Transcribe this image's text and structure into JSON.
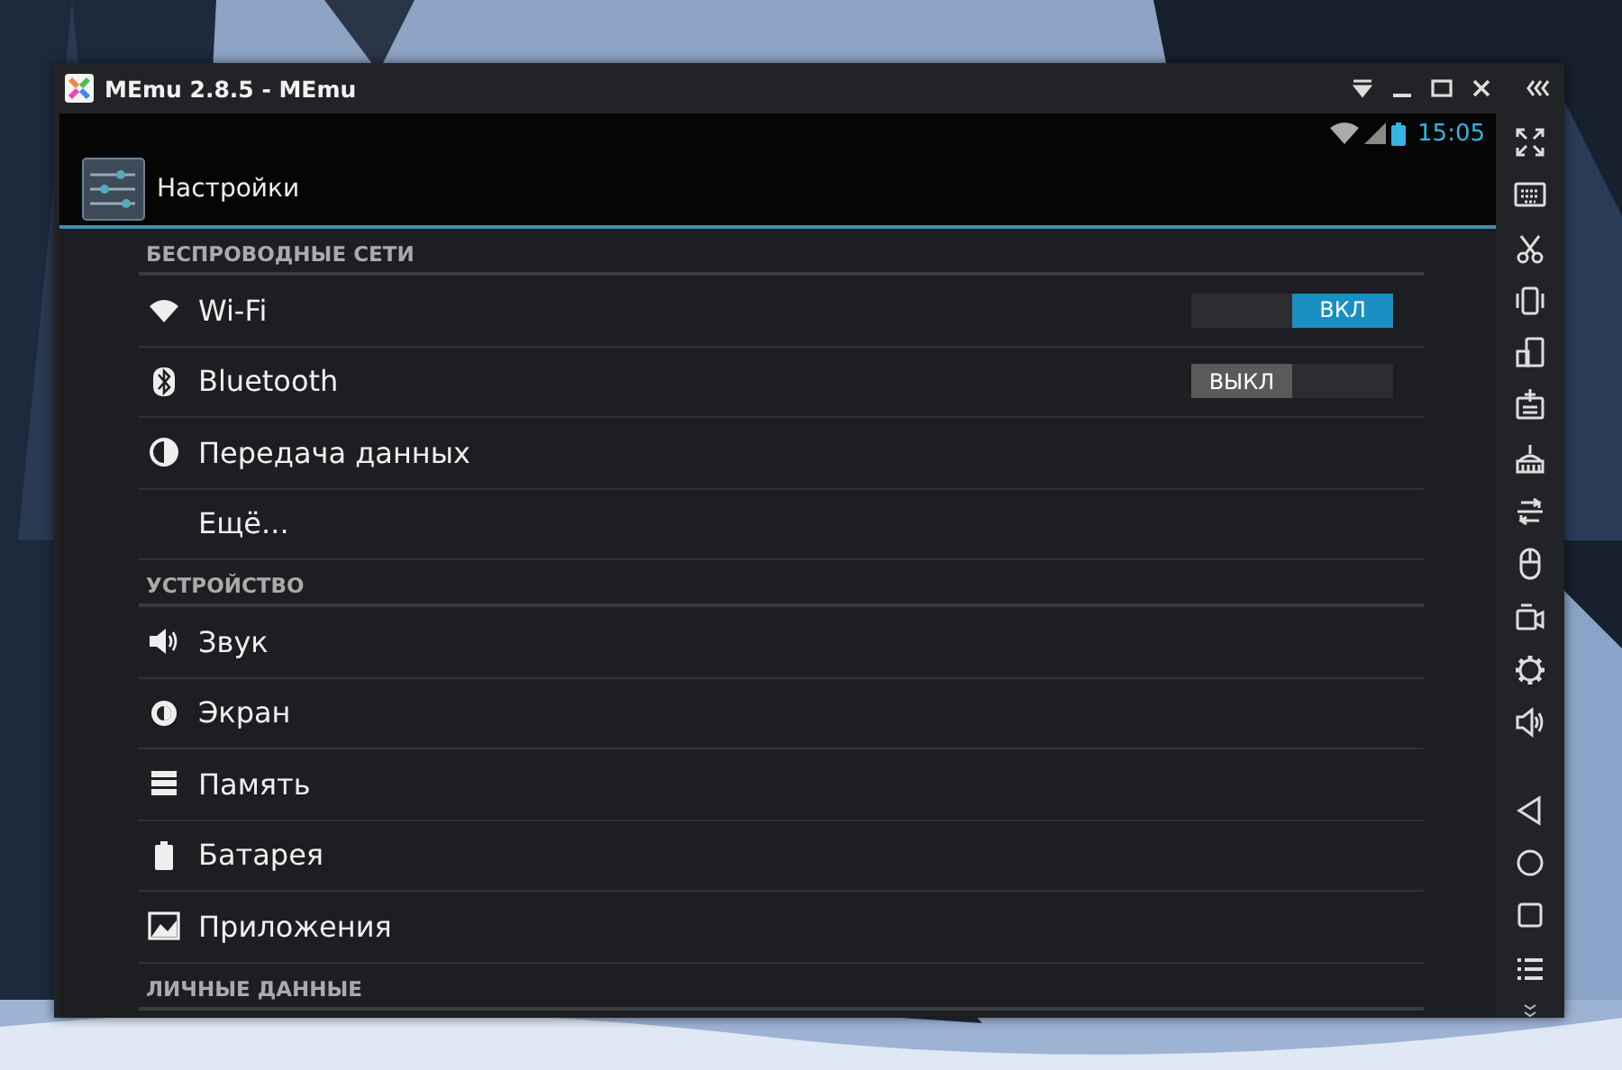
{
  "window": {
    "title": "MEmu 2.8.5 - MEmu"
  },
  "status_bar": {
    "time": "15:05"
  },
  "action_bar": {
    "title": "Настройки"
  },
  "sections": [
    {
      "header": "БЕСПРОВОДНЫЕ СЕТИ",
      "items": [
        {
          "label": "Wi-Fi",
          "kind": "toggle",
          "on": true,
          "toggle_label": "ВКЛ"
        },
        {
          "label": "Bluetooth",
          "kind": "toggle",
          "on": false,
          "toggle_label": "ВЫКЛ"
        },
        {
          "label": "Передача данных",
          "kind": "plain"
        },
        {
          "label": "Ещё...",
          "kind": "plain"
        }
      ]
    },
    {
      "header": "УСТРОЙСТВО",
      "items": [
        {
          "label": "Звук",
          "kind": "plain"
        },
        {
          "label": "Экран",
          "kind": "plain"
        },
        {
          "label": "Память",
          "kind": "plain"
        },
        {
          "label": "Батарея",
          "kind": "plain"
        },
        {
          "label": "Приложения",
          "kind": "plain"
        }
      ]
    },
    {
      "header": "ЛИЧНЫЕ ДАННЫЕ"
    }
  ]
}
